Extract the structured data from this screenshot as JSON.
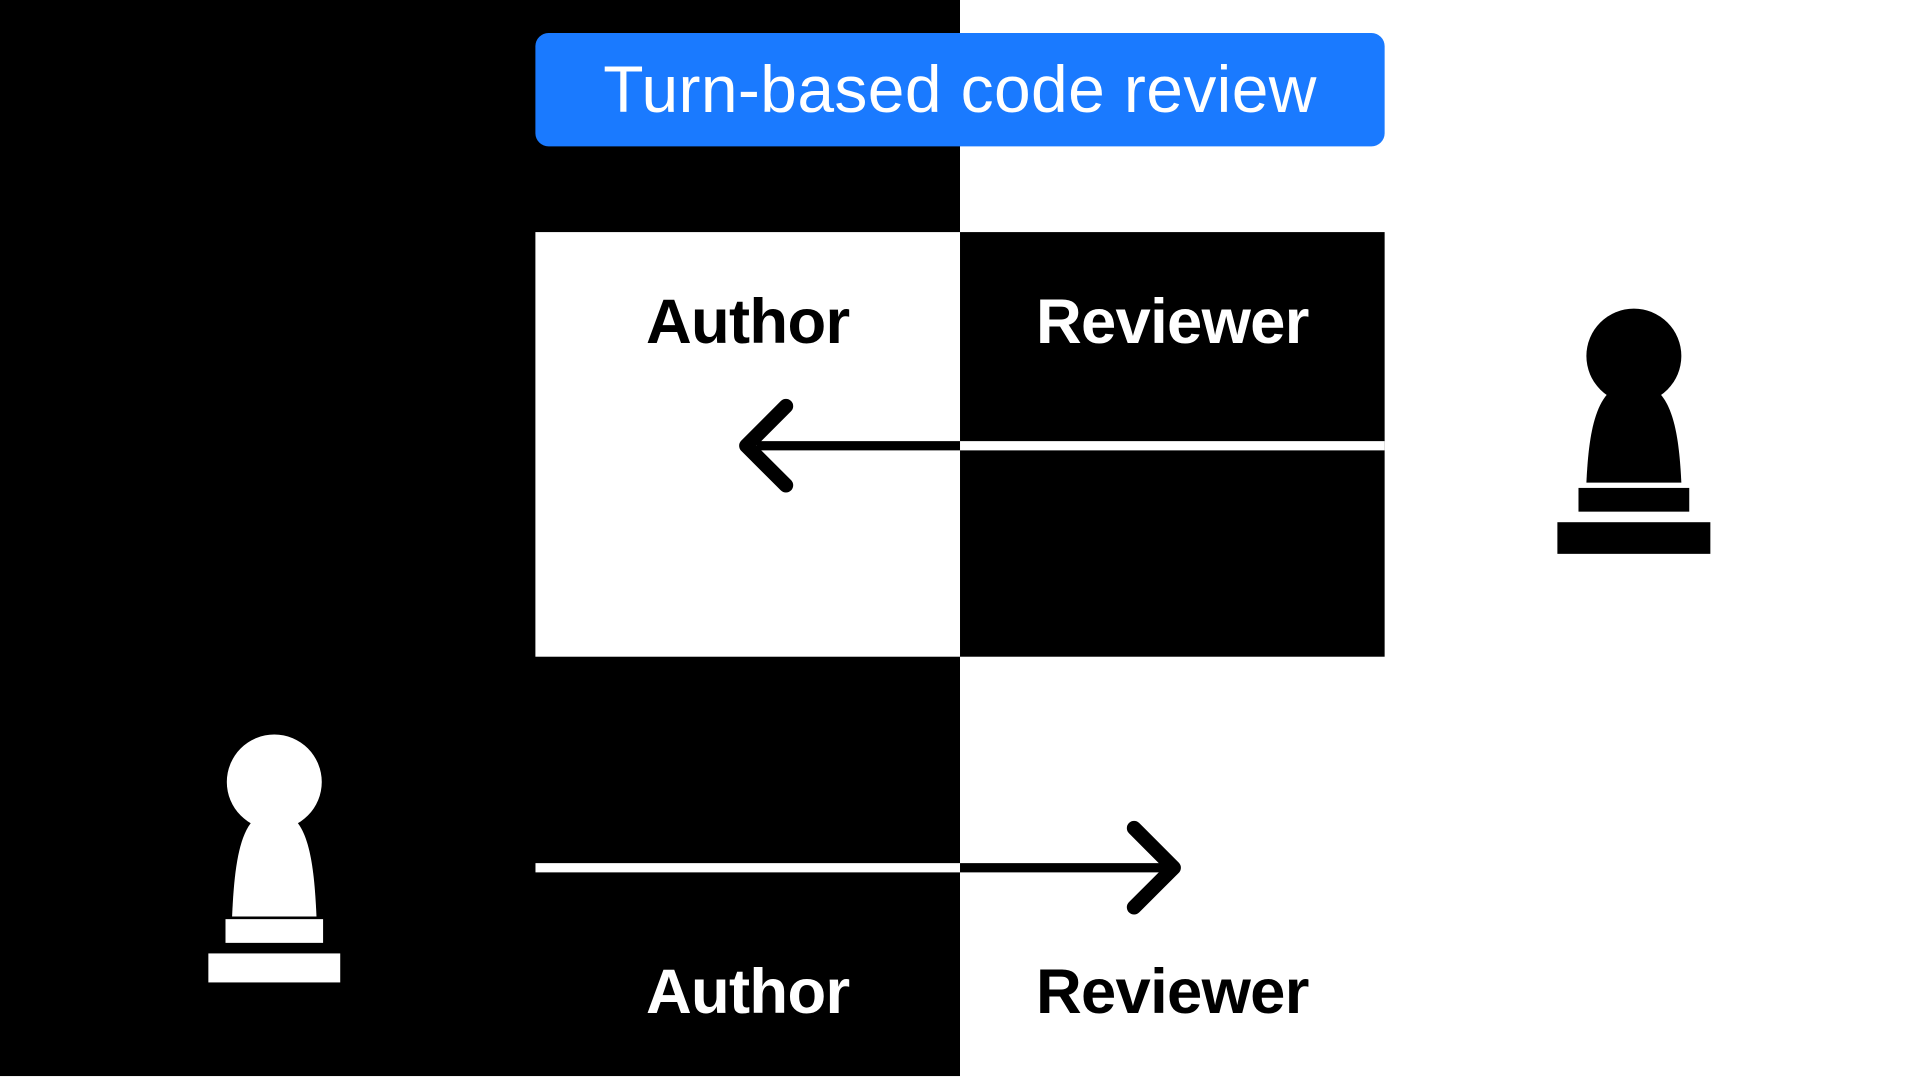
{
  "title": "Turn-based code review",
  "roles": {
    "author": "Author",
    "reviewer": "Reviewer"
  },
  "colors": {
    "banner_bg": "#1a7aff",
    "banner_fg": "#ffffff",
    "black": "#000000",
    "white": "#ffffff"
  },
  "arrows": {
    "top": {
      "direction": "left",
      "from": "reviewer",
      "to": "author"
    },
    "bottom": {
      "direction": "right",
      "from": "author",
      "to": "reviewer"
    }
  },
  "pieces": {
    "left": {
      "color": "white",
      "type": "pawn"
    },
    "right": {
      "color": "black",
      "type": "pawn"
    }
  }
}
